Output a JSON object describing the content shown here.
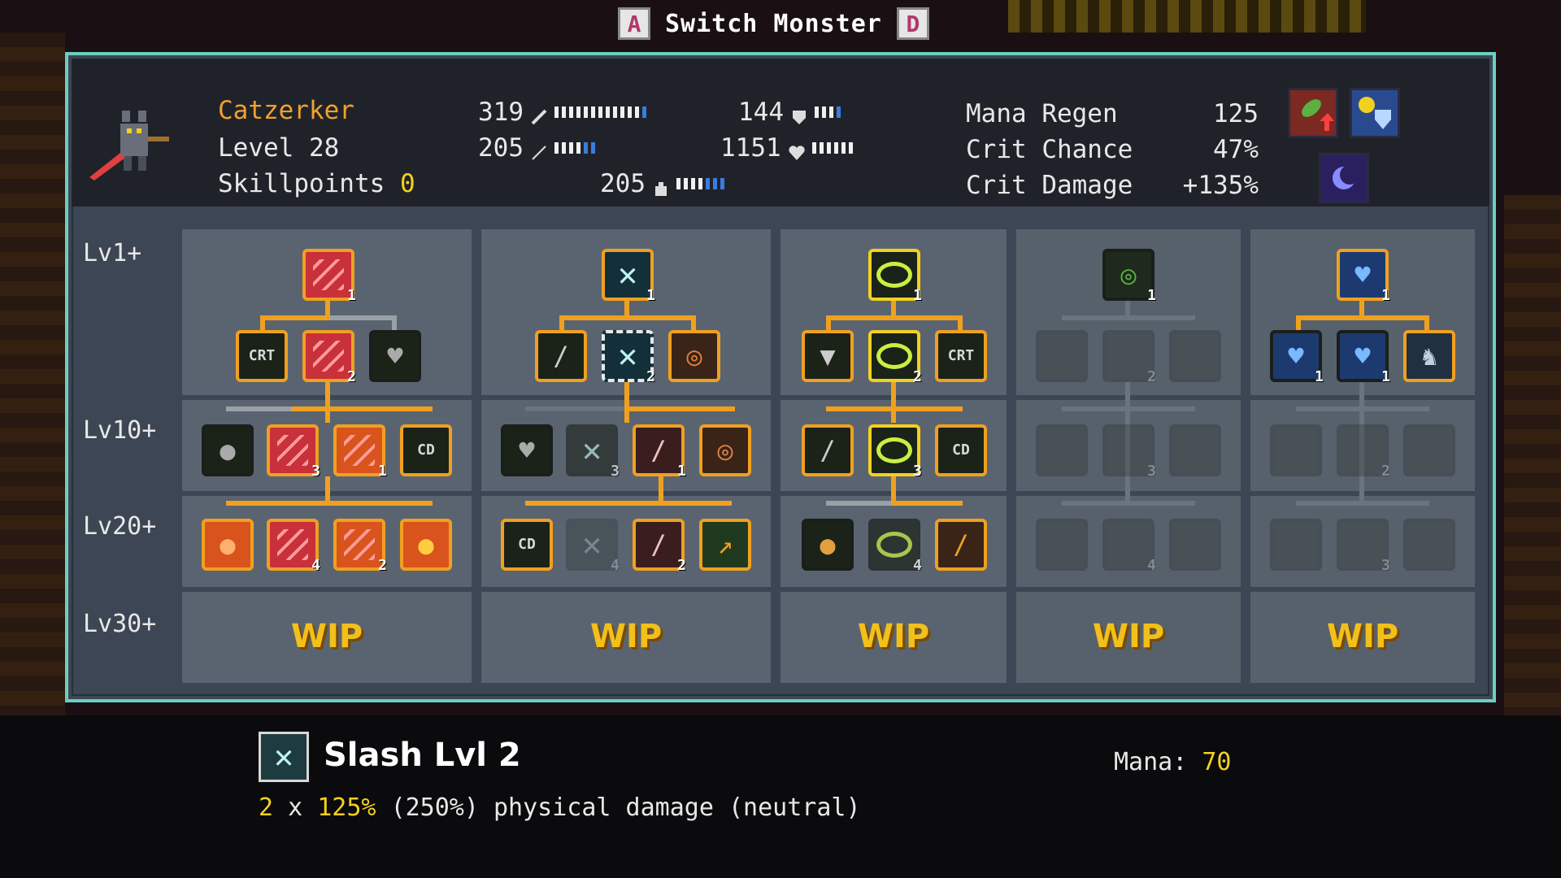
{
  "header": {
    "key_left": "A",
    "title": "Switch Monster",
    "key_right": "D"
  },
  "monster": {
    "name": "Catzerker",
    "level_text": "Level 28",
    "skillpoints_label": "Skillpoints",
    "skillpoints_value": "0",
    "attack": "319",
    "magic": "205",
    "defense": "144",
    "health": "1151",
    "mana": "205",
    "mana_regen_label": "Mana Regen",
    "mana_regen_value": "125",
    "crit_chance_label": "Crit Chance",
    "crit_chance_value": "47%",
    "crit_damage_label": "Crit Damage",
    "crit_damage_value": "+135%"
  },
  "levels": [
    "Lv1+",
    "Lv10+",
    "Lv20+",
    "Lv30+"
  ],
  "wip": [
    "WIP",
    "WIP",
    "WIP",
    "WIP",
    "WIP"
  ],
  "skill_labels": {
    "crt": "CRT",
    "cd": "CD"
  },
  "counts": {
    "c1_top": "1",
    "c1_mid": "2",
    "c1_l10a": "3",
    "c1_l10b": "1",
    "c1_l20a": "4",
    "c1_l20b": "2",
    "c2_top": "1",
    "c2_mid": "2",
    "c2_l10a": "3",
    "c2_l10b": "1",
    "c2_l20a": "4",
    "c2_l20b": "2",
    "c3_top": "1",
    "c3_mid": "2",
    "c3_l10": "3",
    "c3_l20": "4",
    "c4_top": "1",
    "c4_mid": "2",
    "c4_l10": "3",
    "c4_l20": "4",
    "c5_top": "1",
    "c5_a": "1",
    "c5_b": "1",
    "c5_l10": "2",
    "c5_l20": "3"
  },
  "tooltip": {
    "title": "Slash Lvl 2",
    "mana_label": "Mana:",
    "mana_value": "70",
    "desc_hits": "2",
    "desc_x": "x",
    "desc_pct": "125%",
    "desc_rest": "(250%) physical damage (neutral)"
  },
  "colors": {
    "accent": "#f0a020",
    "frame": "#6ad0c0",
    "name": "#f2a030",
    "highlight": "#f2d020"
  }
}
